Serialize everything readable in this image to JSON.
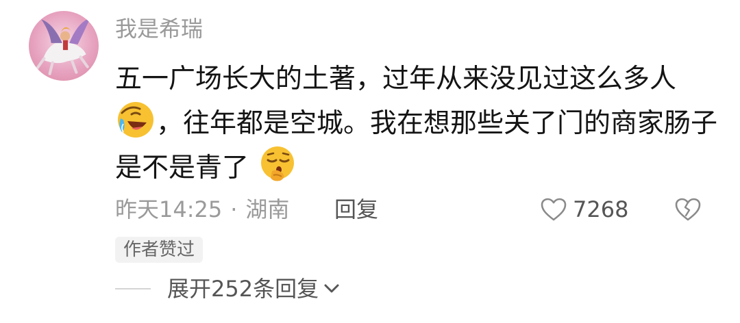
{
  "comment": {
    "username": "我是希瑞",
    "text_part1": "五一广场长大的土著，过年从来没见过这么多人",
    "text_part2": "，往年都是空城。我在想那些关了门的商家肠子是不是青了",
    "emoji_1": "laughing-crying-emoji",
    "emoji_2": "pensive-hand-on-chin-emoji",
    "time": "昨天14:25",
    "separator": "·",
    "location": "湖南",
    "reply_label": "回复",
    "like_count": "7268",
    "author_badge": "作者赞过",
    "expand_replies": "展开252条回复"
  },
  "colors": {
    "secondary_text": "#9a9a9a",
    "primary_text": "#141414",
    "action_text": "#555555",
    "badge_bg": "#f2f2f2",
    "emoji_yellow": "#f7c132"
  },
  "icons": {
    "like": "heart-outline-icon",
    "dislike": "broken-heart-icon",
    "expand": "chevron-down-icon"
  }
}
